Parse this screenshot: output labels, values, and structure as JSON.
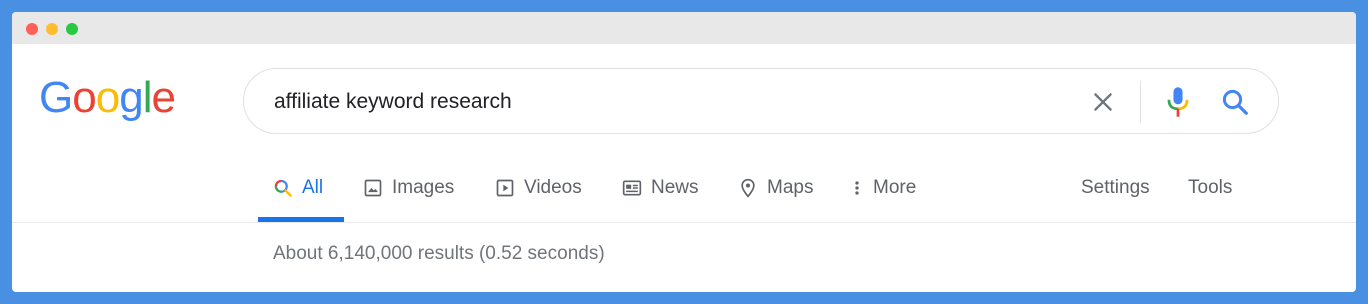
{
  "window": {
    "controls": [
      "close",
      "minimize",
      "zoom"
    ]
  },
  "logo": {
    "letters": [
      {
        "char": "G",
        "color": "#4285f4"
      },
      {
        "char": "o",
        "color": "#ea4335"
      },
      {
        "char": "o",
        "color": "#fbbc05"
      },
      {
        "char": "g",
        "color": "#4285f4"
      },
      {
        "char": "l",
        "color": "#34a853"
      },
      {
        "char": "e",
        "color": "#ea4335"
      }
    ]
  },
  "search": {
    "query": "affiliate keyword research",
    "icons": [
      "close-icon",
      "microphone-icon",
      "search-icon"
    ]
  },
  "tabs": [
    {
      "label": "All",
      "icon": "search-icon",
      "active": true
    },
    {
      "label": "Images",
      "icon": "image-icon",
      "active": false
    },
    {
      "label": "Videos",
      "icon": "play-icon",
      "active": false
    },
    {
      "label": "News",
      "icon": "newspaper-icon",
      "active": false
    },
    {
      "label": "Maps",
      "icon": "map-pin-icon",
      "active": false
    },
    {
      "label": "More",
      "icon": "more-vert-icon",
      "active": false
    }
  ],
  "tools": {
    "settings_label": "Settings",
    "tools_label": "Tools"
  },
  "results": {
    "stats": "About 6,140,000 results (0.52 seconds)"
  },
  "colors": {
    "accent": "#1a73e8",
    "frame": "#4a90e2",
    "tab_text": "#5f6368",
    "stats_text": "#70757a"
  }
}
